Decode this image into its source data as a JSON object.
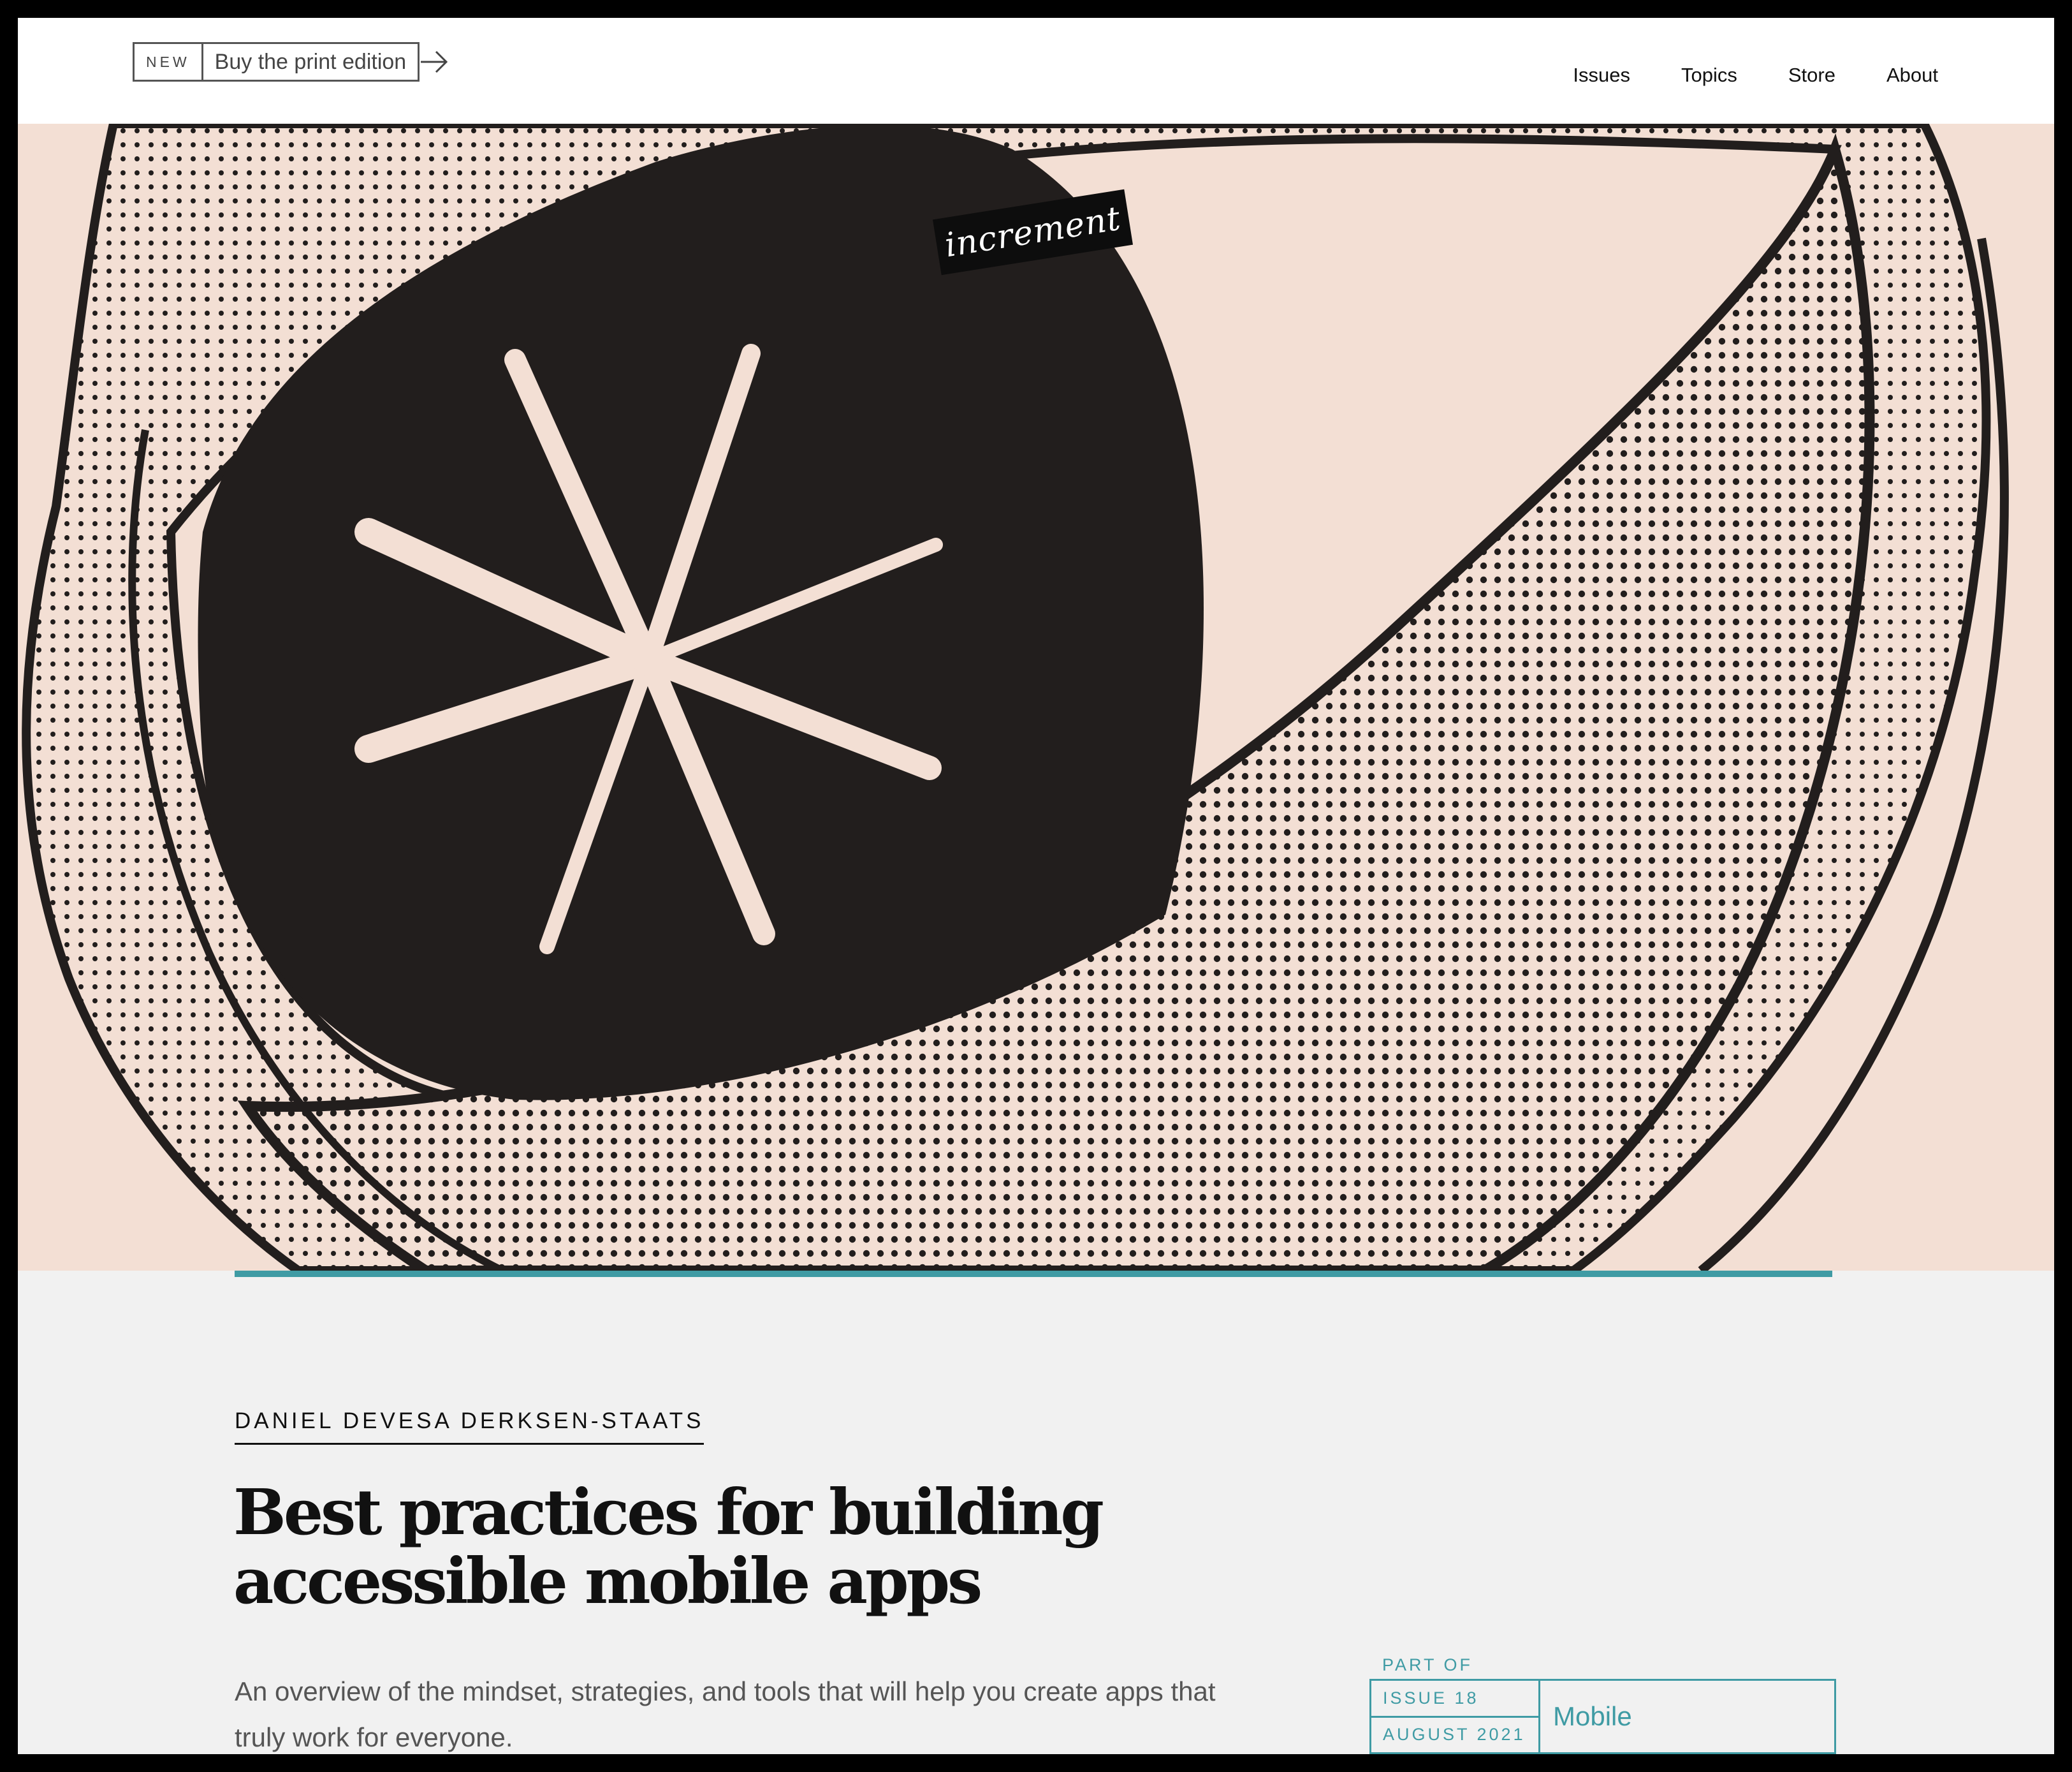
{
  "header": {
    "promo_badge": "NEW",
    "promo_label": "Buy the print edition",
    "nav": [
      "Issues",
      "Topics",
      "Store",
      "About"
    ]
  },
  "brand": {
    "logo_text": "increment"
  },
  "hero": {
    "background": "#f3dfd4",
    "ink": "#221e1d",
    "accent_rule": "#3f9ba4",
    "illustration": "abstract eye with star pupil"
  },
  "article": {
    "author": "DANIEL DEVESA DERKSEN-STAATS",
    "title_line1": "Best practices for building",
    "title_line2": "accessible mobile apps",
    "dek_line1": "An overview of the mindset, strategies, and tools that will help you create apps that",
    "dek_line2": "truly work for everyone."
  },
  "issue": {
    "part_of": "PART OF",
    "number": "ISSUE 18",
    "date": "AUGUST 2021",
    "topic": "Mobile"
  },
  "colors": {
    "accent": "#3f9ba4",
    "page_bg": "#f1f1f1",
    "text": "#111111"
  }
}
